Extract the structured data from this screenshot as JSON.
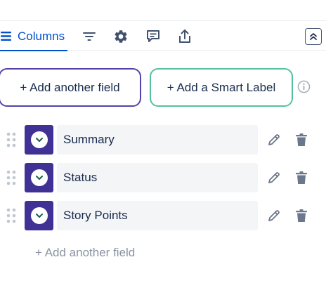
{
  "toolbar": {
    "columns_tab_label": "Columns",
    "accent_color": "#0052cc",
    "icons": [
      "columns-icon",
      "filter-icon",
      "settings-gear-icon",
      "comment-icon",
      "share-upload-icon",
      "chevron-double-up-icon"
    ]
  },
  "actions": {
    "add_field_label": "+ Add another field",
    "add_smart_label": "+ Add a Smart Label",
    "add_field_border_color": "#5243aa",
    "add_smart_border_color": "#57c19a"
  },
  "fields": [
    {
      "name": "Summary"
    },
    {
      "name": "Status"
    },
    {
      "name": "Story Points"
    }
  ],
  "footer": {
    "add_link_label": "+ Add another field"
  },
  "colors": {
    "chevron_tile": "#403294",
    "field_bg": "#f4f5f7",
    "icon_gray": "#6b778c"
  }
}
